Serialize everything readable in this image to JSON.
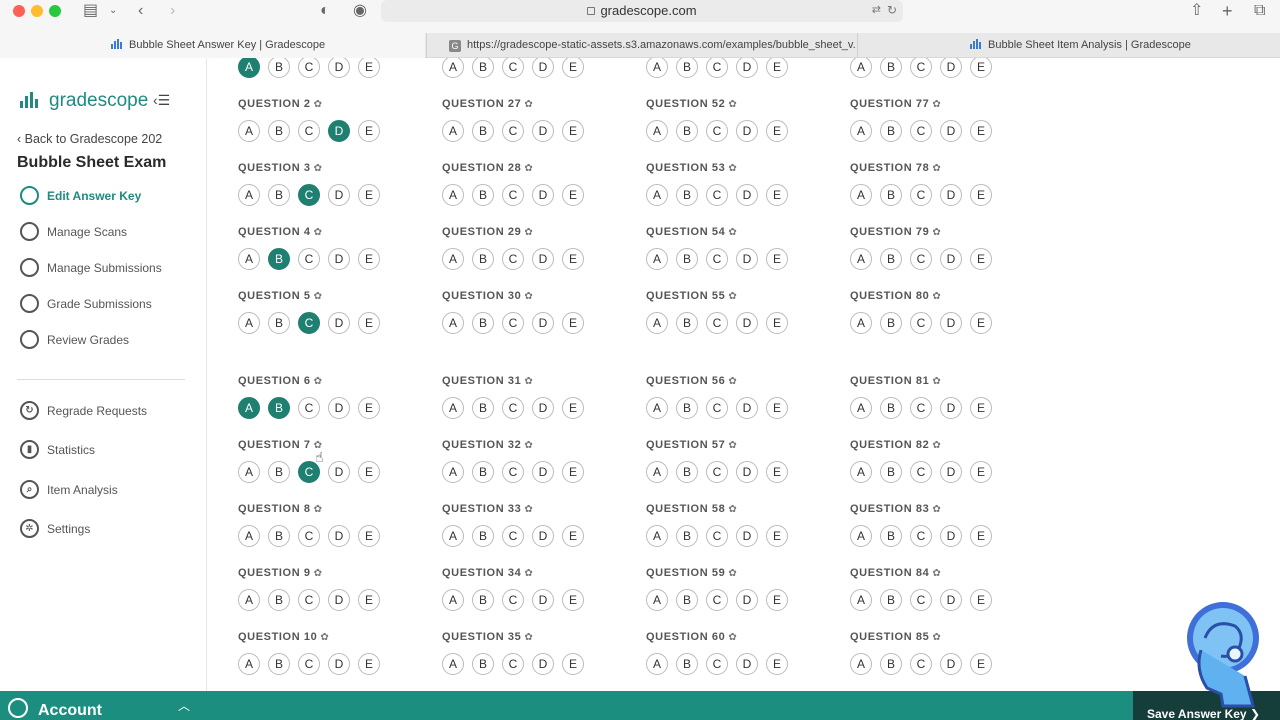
{
  "browser": {
    "address": "gradescope.com",
    "tabs": [
      {
        "title": "Bubble Sheet Answer Key | Gradescope",
        "active": true
      },
      {
        "title": "https://gradescope-static-assets.s3.amazonaws.com/examples/bubble_sheet_v...",
        "active": false
      },
      {
        "title": "Bubble Sheet Item Analysis | Gradescope",
        "active": false
      }
    ]
  },
  "sidebar": {
    "logo_text": "gradescope",
    "collapse_label": "‹☰",
    "back_link": "‹ Back to Gradescope 202",
    "course_title": "Bubble Sheet Exam",
    "steps": [
      {
        "label": "Edit Answer Key",
        "active": true
      },
      {
        "label": "Manage Scans",
        "active": false
      },
      {
        "label": "Manage Submissions",
        "active": false
      },
      {
        "label": "Grade Submissions",
        "active": false
      },
      {
        "label": "Review Grades",
        "active": false
      }
    ],
    "tools": [
      {
        "label": "Regrade Requests",
        "icon": "regrade-icon"
      },
      {
        "label": "Statistics",
        "icon": "statistics-icon"
      },
      {
        "label": "Item Analysis",
        "icon": "search-icon"
      },
      {
        "label": "Settings",
        "icon": "gear-icon"
      }
    ]
  },
  "answer_key": {
    "options": [
      "A",
      "B",
      "C",
      "D",
      "E"
    ],
    "colors": {
      "selected": "#1f7f70",
      "accent": "#1f8a80"
    },
    "top_partial_row": [
      {
        "selected": [
          "A"
        ]
      },
      {
        "selected": []
      },
      {
        "selected": []
      },
      {
        "selected": []
      }
    ],
    "columns": [
      {
        "questions": [
          {
            "label": "QUESTION 2",
            "selected": [
              "D"
            ]
          },
          {
            "label": "QUESTION 3",
            "selected": [
              "C"
            ]
          },
          {
            "label": "QUESTION 4",
            "selected": [
              "B"
            ]
          },
          {
            "label": "QUESTION 5",
            "selected": [
              "C"
            ]
          },
          {
            "label": "QUESTION 6",
            "selected": [
              "A",
              "B"
            ]
          },
          {
            "label": "QUESTION 7",
            "selected": [
              "C"
            ]
          },
          {
            "label": "QUESTION 8",
            "selected": []
          },
          {
            "label": "QUESTION 9",
            "selected": []
          },
          {
            "label": "QUESTION 10",
            "selected": []
          }
        ]
      },
      {
        "questions": [
          {
            "label": "QUESTION 27",
            "selected": []
          },
          {
            "label": "QUESTION 28",
            "selected": []
          },
          {
            "label": "QUESTION 29",
            "selected": []
          },
          {
            "label": "QUESTION 30",
            "selected": []
          },
          {
            "label": "QUESTION 31",
            "selected": []
          },
          {
            "label": "QUESTION 32",
            "selected": []
          },
          {
            "label": "QUESTION 33",
            "selected": []
          },
          {
            "label": "QUESTION 34",
            "selected": []
          },
          {
            "label": "QUESTION 35",
            "selected": []
          }
        ]
      },
      {
        "questions": [
          {
            "label": "QUESTION 52",
            "selected": []
          },
          {
            "label": "QUESTION 53",
            "selected": []
          },
          {
            "label": "QUESTION 54",
            "selected": []
          },
          {
            "label": "QUESTION 55",
            "selected": []
          },
          {
            "label": "QUESTION 56",
            "selected": []
          },
          {
            "label": "QUESTION 57",
            "selected": []
          },
          {
            "label": "QUESTION 58",
            "selected": []
          },
          {
            "label": "QUESTION 59",
            "selected": []
          },
          {
            "label": "QUESTION 60",
            "selected": []
          }
        ]
      },
      {
        "questions": [
          {
            "label": "QUESTION 77",
            "selected": []
          },
          {
            "label": "QUESTION 78",
            "selected": []
          },
          {
            "label": "QUESTION 79",
            "selected": []
          },
          {
            "label": "QUESTION 80",
            "selected": []
          },
          {
            "label": "QUESTION 81",
            "selected": []
          },
          {
            "label": "QUESTION 82",
            "selected": []
          },
          {
            "label": "QUESTION 83",
            "selected": []
          },
          {
            "label": "QUESTION 84",
            "selected": []
          },
          {
            "label": "QUESTION 85",
            "selected": []
          }
        ]
      }
    ]
  },
  "footer": {
    "account_label": "Account",
    "save_label": "Save Answer Key ❯"
  }
}
